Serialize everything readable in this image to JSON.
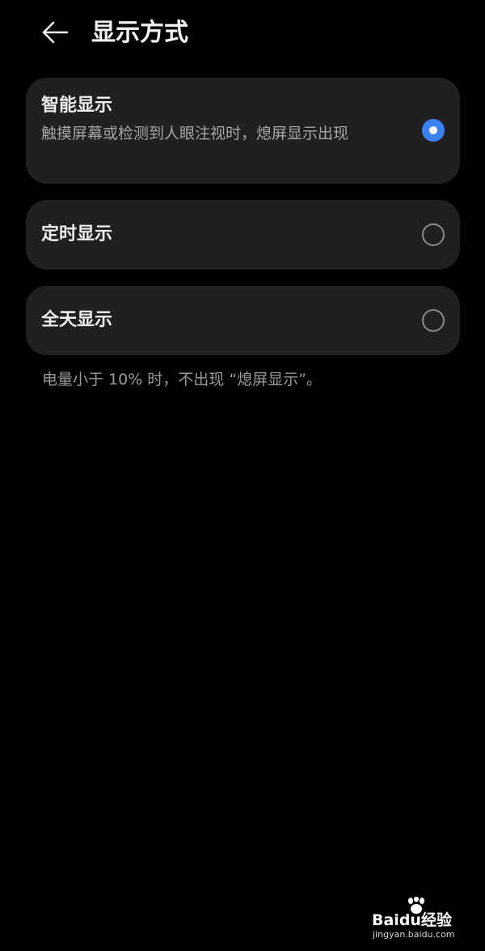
{
  "header": {
    "back_icon": "arrow-left-icon",
    "title": "显示方式"
  },
  "options": [
    {
      "title": "智能显示",
      "description": "触摸屏幕或检测到人眼注视时，熄屏显示出现",
      "selected": true
    },
    {
      "title": "定时显示",
      "selected": false
    },
    {
      "title": "全天显示",
      "selected": false
    }
  ],
  "footnote": "电量小于 10% 时，不出现 “熄屏显示”。",
  "watermark": {
    "brand": "Baidu经验",
    "url": "jingyan.baidu.com"
  },
  "colors": {
    "background": "#000000",
    "card": "#202022",
    "accent": "#3d82f5",
    "secondary_text": "#a6a6a6"
  }
}
